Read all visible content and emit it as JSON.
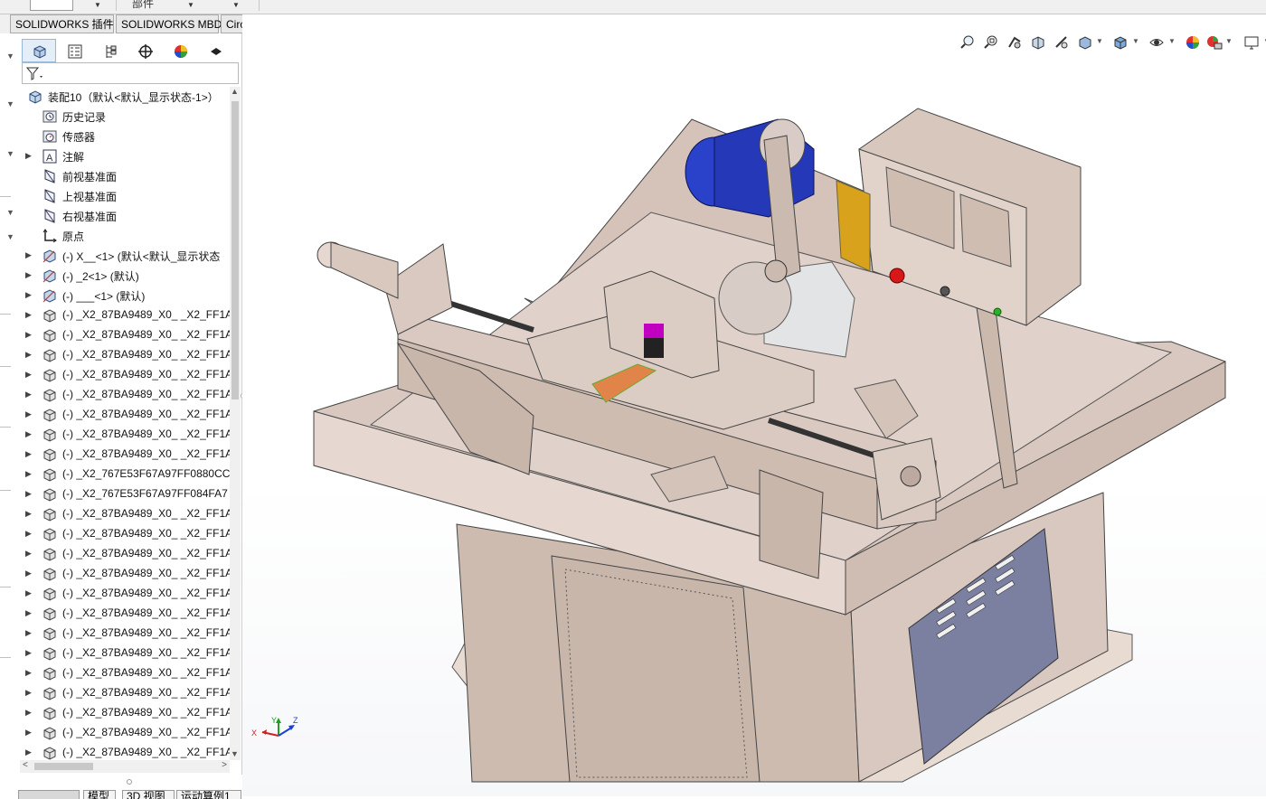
{
  "top_strip": {
    "part_label": "部件"
  },
  "tabs": [
    "SOLIDWORKS 插件",
    "SOLIDWORKS MBD",
    "CircuitWorks"
  ],
  "feature_tree": {
    "root": "装配10（默认<默认_显示状态-1>）",
    "items": [
      {
        "label": "历史记录",
        "icon": "history-icon",
        "expand": false
      },
      {
        "label": "传感器",
        "icon": "sensor-icon",
        "expand": false
      },
      {
        "label": "注解",
        "icon": "annotation-icon",
        "expand": true
      },
      {
        "label": "前视基准面",
        "icon": "plane-icon",
        "expand": false
      },
      {
        "label": "上视基准面",
        "icon": "plane-icon",
        "expand": false
      },
      {
        "label": "右视基准面",
        "icon": "plane-icon",
        "expand": false
      },
      {
        "label": "原点",
        "icon": "origin-icon",
        "expand": false
      },
      {
        "label": "(-) X__<1> (默认<默认_显示状态",
        "icon": "subassembly-icon",
        "expand": true
      },
      {
        "label": "(-) _2<1> (默认)",
        "icon": "subassembly-icon",
        "expand": true
      },
      {
        "label": "(-) ___<1> (默认)",
        "icon": "subassembly-icon",
        "expand": true
      },
      {
        "label": "(-) _X2_87BA9489_X0_ _X2_FF1A",
        "icon": "part-icon",
        "expand": true
      },
      {
        "label": "(-) _X2_87BA9489_X0_ _X2_FF1A",
        "icon": "part-icon",
        "expand": true
      },
      {
        "label": "(-) _X2_87BA9489_X0_ _X2_FF1A",
        "icon": "part-icon",
        "expand": true
      },
      {
        "label": "(-) _X2_87BA9489_X0_ _X2_FF1A",
        "icon": "part-icon",
        "expand": true
      },
      {
        "label": "(-) _X2_87BA9489_X0_ _X2_FF1A",
        "icon": "part-icon",
        "expand": true
      },
      {
        "label": "(-) _X2_87BA9489_X0_ _X2_FF1A",
        "icon": "part-icon",
        "expand": true
      },
      {
        "label": "(-) _X2_87BA9489_X0_ _X2_FF1A",
        "icon": "part-icon",
        "expand": true
      },
      {
        "label": "(-) _X2_87BA9489_X0_ _X2_FF1A",
        "icon": "part-icon",
        "expand": true
      },
      {
        "label": "(-) _X2_767E53F67A97FF0880CC",
        "icon": "part-icon",
        "expand": true
      },
      {
        "label": "(-) _X2_767E53F67A97FF084FA7",
        "icon": "part-icon",
        "expand": true
      },
      {
        "label": "(-) _X2_87BA9489_X0_ _X2_FF1A",
        "icon": "part-icon",
        "expand": true
      },
      {
        "label": "(-) _X2_87BA9489_X0_ _X2_FF1A",
        "icon": "part-icon",
        "expand": true
      },
      {
        "label": "(-) _X2_87BA9489_X0_ _X2_FF1A",
        "icon": "part-icon",
        "expand": true
      },
      {
        "label": "(-) _X2_87BA9489_X0_ _X2_FF1A",
        "icon": "part-icon",
        "expand": true
      },
      {
        "label": "(-) _X2_87BA9489_X0_ _X2_FF1A",
        "icon": "part-icon",
        "expand": true
      },
      {
        "label": "(-) _X2_87BA9489_X0_ _X2_FF1A",
        "icon": "part-icon",
        "expand": true
      },
      {
        "label": "(-) _X2_87BA9489_X0_ _X2_FF1A",
        "icon": "part-icon",
        "expand": true
      },
      {
        "label": "(-) _X2_87BA9489_X0_ _X2_FF1A",
        "icon": "part-icon",
        "expand": true
      },
      {
        "label": "(-) _X2_87BA9489_X0_ _X2_FF1A",
        "icon": "part-icon",
        "expand": true
      },
      {
        "label": "(-) _X2_87BA9489_X0_ _X2_FF1A",
        "icon": "part-icon",
        "expand": true
      },
      {
        "label": "(-) _X2_87BA9489_X0_ _X2_FF1A",
        "icon": "part-icon",
        "expand": true
      },
      {
        "label": "(-) _X2_87BA9489_X0_ _X2_FF1A",
        "icon": "part-icon",
        "expand": true
      },
      {
        "label": "(-) _X2_87BA9489_X0_ _X2_FF1A",
        "icon": "part-icon",
        "expand": true
      }
    ]
  },
  "bottom_tabs": [
    "模型",
    "3D 视图",
    "运动算例1"
  ],
  "triad": {
    "x": "X",
    "y": "Y",
    "z": "Z"
  },
  "colors": {
    "machine_body": "#dccdc5",
    "motor": "#2a41c9",
    "magenta": "#c200c0",
    "orange": "#e0844a",
    "yellow": "#d8a21c",
    "panel_blue": "#7a7fa0"
  }
}
